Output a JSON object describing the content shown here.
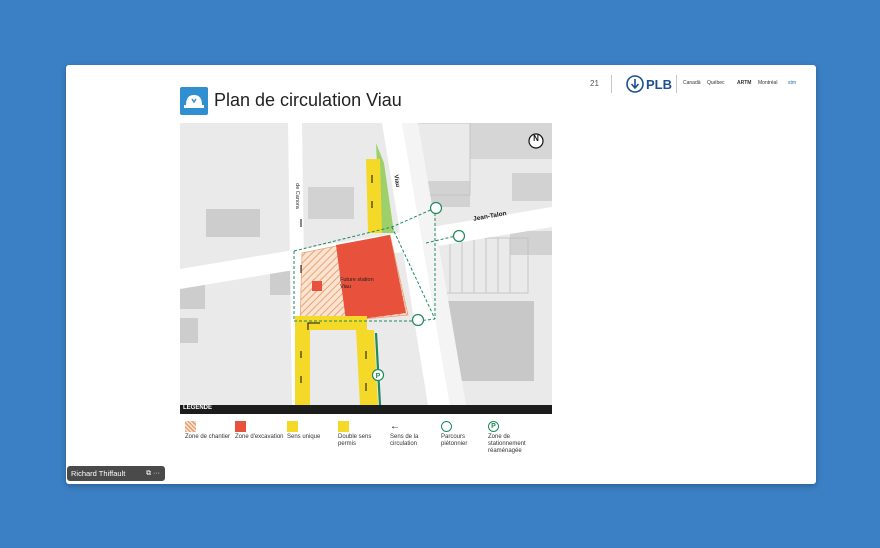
{
  "slide": {
    "title": "Plan de circulation Viau",
    "page_number": "21",
    "logo_text": "PLB",
    "partners": [
      "Canadä",
      "Québec",
      "ARTM",
      "Montréal",
      "stm"
    ]
  },
  "map": {
    "street_viau": "Viau",
    "street_jean_talon": "Jean-Talon",
    "street_de_canora": "de Canora",
    "station_label": "Future station Viau",
    "north_label": "N"
  },
  "legend": {
    "header": "LÉGENDE",
    "items": [
      {
        "label": "Zone de chantier"
      },
      {
        "label": "Zone d'excavation"
      },
      {
        "label": "Sens unique"
      },
      {
        "label": "Double sens permis"
      },
      {
        "label": "Sens de la circulation"
      },
      {
        "label": "Parcours piétonnier"
      },
      {
        "label": "Zone de stationnement réaménagée"
      }
    ]
  },
  "presenter": {
    "name": "Richard Thiffault"
  },
  "colors": {
    "background": "#3b7fc4",
    "excavation": "#e8513b",
    "one_way": "#f5d928",
    "pedestrian": "#1f8a5c",
    "parking": "#1f8a5c"
  }
}
